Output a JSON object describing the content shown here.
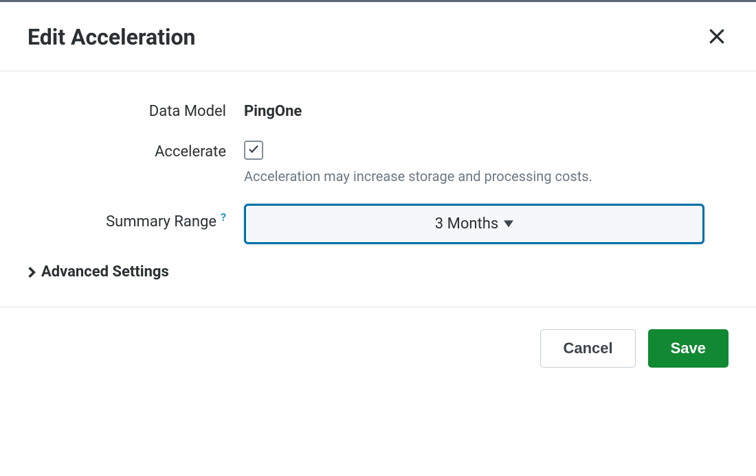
{
  "header": {
    "title": "Edit Acceleration"
  },
  "form": {
    "data_model_label": "Data Model",
    "data_model_value": "PingOne",
    "accelerate_label": "Accelerate",
    "accelerate_checked": true,
    "accelerate_help": "Acceleration may increase storage and processing costs.",
    "summary_range_label": "Summary Range",
    "summary_help_symbol": "?",
    "summary_range_value": "3 Months",
    "advanced_label": "Advanced Settings"
  },
  "footer": {
    "cancel_label": "Cancel",
    "save_label": "Save"
  }
}
